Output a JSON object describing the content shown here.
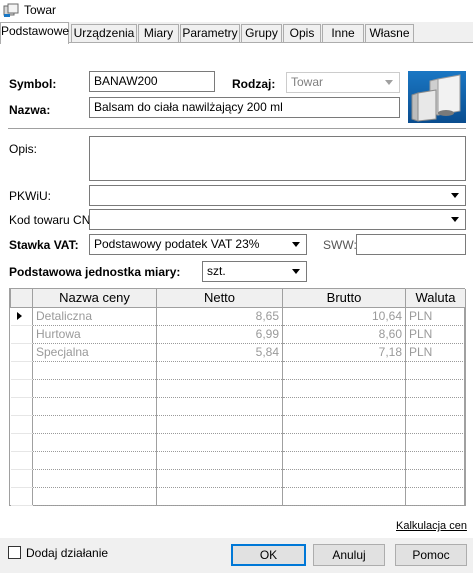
{
  "window": {
    "title": "Towar"
  },
  "tabs": [
    "Podstawowe",
    "Urządzenia",
    "Miary",
    "Parametry",
    "Grupy",
    "Opis",
    "Inne",
    "Własne"
  ],
  "form": {
    "symbol_label": "Symbol:",
    "symbol_value": "BANAW200",
    "rodzaj_label": "Rodzaj:",
    "rodzaj_value": "Towar",
    "nazwa_label": "Nazwa:",
    "nazwa_value": "Balsam do ciała nawilżający 200 ml",
    "opis_label": "Opis:",
    "pkwiu_label": "PKWiU:",
    "kod_cn_label": "Kod towaru CN:",
    "stawka_vat_label": "Stawka VAT:",
    "stawka_vat_value": "Podstawowy podatek VAT 23%",
    "sww_label": "SWW:",
    "jednostka_label": "Podstawowa jednostka miary:",
    "jednostka_value": "szt."
  },
  "price_table": {
    "columns": [
      "Nazwa ceny",
      "Netto",
      "Brutto",
      "Waluta"
    ],
    "rows": [
      {
        "nazwa": "Detaliczna",
        "netto": "8,65",
        "brutto": "10,64",
        "waluta": "PLN"
      },
      {
        "nazwa": "Hurtowa",
        "netto": "6,99",
        "brutto": "8,60",
        "waluta": "PLN"
      },
      {
        "nazwa": "Specjalna",
        "netto": "5,84",
        "brutto": "7,18",
        "waluta": "PLN"
      }
    ]
  },
  "kalkulacja_link": "Kalkulacja cen",
  "footer": {
    "dodaj_dzialanie": "Dodaj działanie",
    "ok": "OK",
    "anuluj": "Anuluj",
    "pomoc": "Pomoc"
  },
  "icons": {
    "app": "box-icon",
    "product": "product-boxes-icon"
  },
  "colors": {
    "default_button_border": "#0078d7",
    "product_image_bg": "#1a77c4",
    "grid_text": "#9a9a9a"
  }
}
